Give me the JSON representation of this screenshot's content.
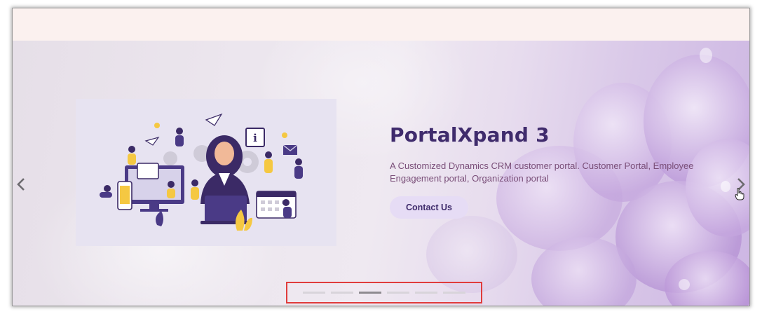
{
  "slide": {
    "title": "PortalXpand 3",
    "description": "A Customized Dynamics CRM customer portal. Customer Portal, Employee Engagement portal, Organization portal",
    "cta_label": "Contact Us",
    "illustration_text": "i"
  },
  "carousel": {
    "prev_icon": "chevron-left-icon",
    "next_icon": "chevron-right-icon",
    "indicator_count": 6,
    "active_index": 2
  },
  "colors": {
    "top_bar": "#fbf1ef",
    "title": "#3f2b6c",
    "description": "#7a4f79",
    "button_bg": "#e6dcf5",
    "highlight_border": "#e03c3c"
  }
}
